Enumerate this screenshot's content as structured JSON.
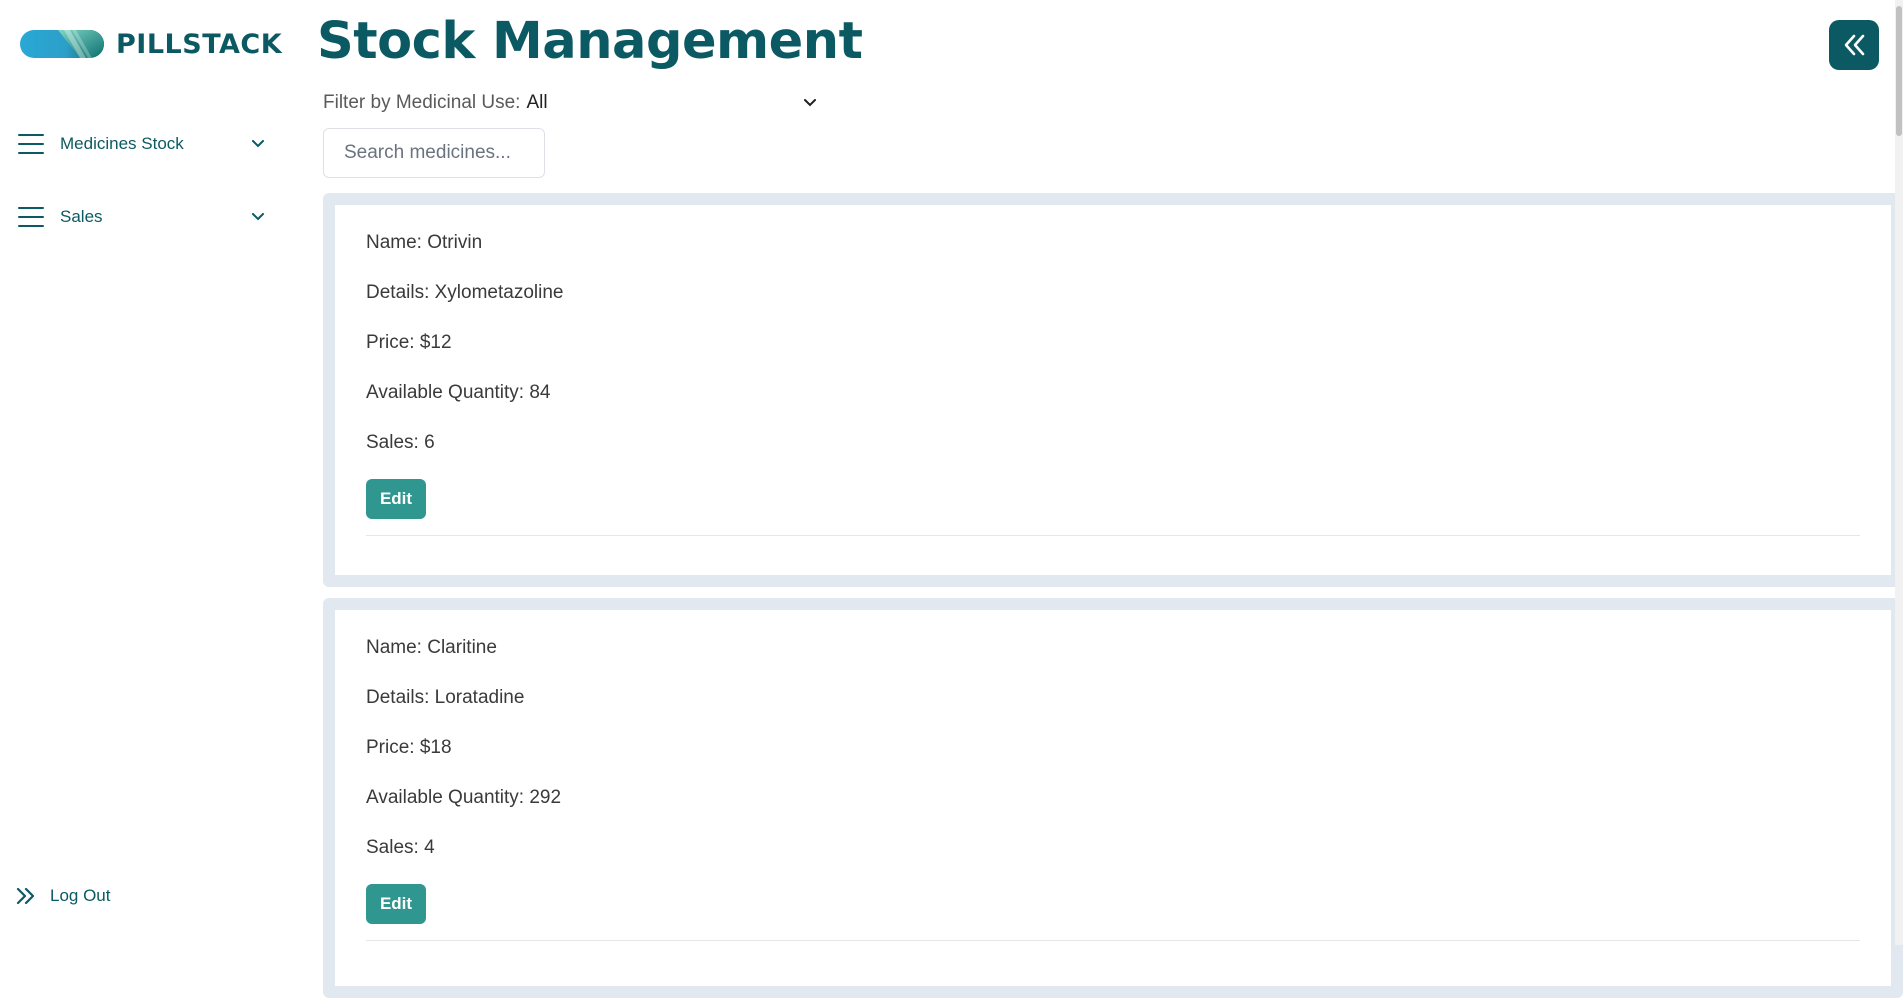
{
  "app": {
    "name": "PILLSTACK"
  },
  "sidebar": {
    "items": [
      {
        "label": "Medicines Stock",
        "icon": "menu-icon"
      },
      {
        "label": "Sales",
        "icon": "menu-icon"
      }
    ],
    "logout_label": "Log Out"
  },
  "page": {
    "title": "Stock Management"
  },
  "filter": {
    "label": "Filter by Medicinal Use:",
    "value": "All"
  },
  "search": {
    "placeholder": "Search medicines..."
  },
  "medicines": [
    {
      "name": "Name: Otrivin",
      "details": "Details: Xylometazoline",
      "price": "Price: $12",
      "quantity": "Available Quantity: 84",
      "sales": "Sales: 6",
      "edit_label": "Edit"
    },
    {
      "name": "Name: Claritine",
      "details": "Details: Loratadine",
      "price": "Price: $18",
      "quantity": "Available Quantity: 292",
      "sales": "Sales: 4",
      "edit_label": "Edit"
    }
  ],
  "colors": {
    "brand": "#0b5a63",
    "button": "#2f9690",
    "card_border": "#e2e8f0"
  }
}
